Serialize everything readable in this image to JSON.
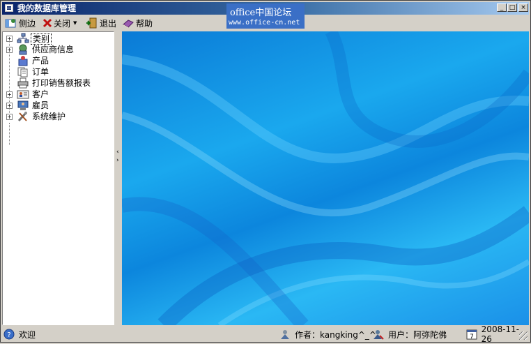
{
  "window": {
    "title": "我的数据库管理",
    "controls": {
      "minimize": "_",
      "maximize": "□",
      "close": "×"
    }
  },
  "watermark": {
    "line1": "office中国论坛",
    "line2": "www.office-cn.net"
  },
  "toolbar": {
    "sidebar": {
      "label": "侧边",
      "icon": "sidebar-icon"
    },
    "close": {
      "label": "关闭",
      "icon": "close-icon"
    },
    "exit": {
      "label": "退出",
      "icon": "exit-door-icon"
    },
    "help": {
      "label": "帮助",
      "icon": "help-book-icon"
    }
  },
  "tree": {
    "items": [
      {
        "label": "类别",
        "icon": "category-icon",
        "expandable": true,
        "expander": "+",
        "selected": true
      },
      {
        "label": "供应商信息",
        "icon": "supplier-icon",
        "expandable": true,
        "expander": "+"
      },
      {
        "label": "产品",
        "icon": "product-icon",
        "expandable": false
      },
      {
        "label": "订单",
        "icon": "order-icon",
        "expandable": false
      },
      {
        "label": "打印销售额报表",
        "icon": "printer-icon",
        "expandable": false
      },
      {
        "label": "客户",
        "icon": "customer-icon",
        "expandable": true,
        "expander": "+"
      },
      {
        "label": "雇员",
        "icon": "employee-icon",
        "expandable": true,
        "expander": "+"
      },
      {
        "label": "系统维护",
        "icon": "tools-icon",
        "expandable": true,
        "expander": "+"
      }
    ]
  },
  "splitter": {
    "left_arrow": "‹",
    "right_arrow": "›"
  },
  "statusbar": {
    "welcome": "欢迎",
    "author": "作者：kangking^_^",
    "user": "用户：阿弥陀佛",
    "date": "2008-11-26",
    "calendar_day": "7"
  },
  "colors": {
    "titlebar_start": "#0a246a",
    "titlebar_end": "#a6caf0",
    "background_blue": "#1aa8ee"
  }
}
